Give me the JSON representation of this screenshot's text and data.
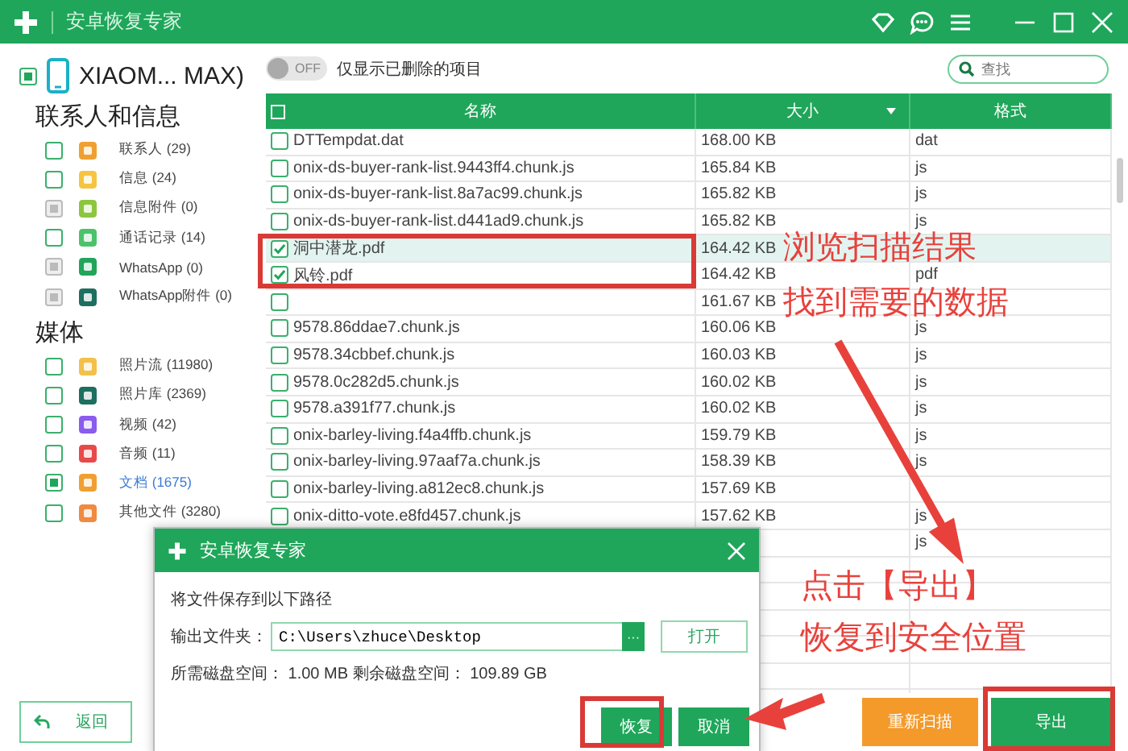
{
  "window": {
    "title": "安卓恢复专家"
  },
  "device": {
    "name": "XIAOM... MAX)",
    "checked": true
  },
  "filter": {
    "toggle_text": "OFF",
    "on": false,
    "label": "仅显示已删除的项目"
  },
  "search": {
    "placeholder": "查找"
  },
  "sidebar": [
    {
      "title": "联系人和信息",
      "items": [
        {
          "label": "联系人 (29)",
          "color": "#f0a030",
          "checked": false,
          "disabled": false,
          "selected": false
        },
        {
          "label": "信息 (24)",
          "color": "#f5c542",
          "checked": false,
          "disabled": false,
          "selected": false
        },
        {
          "label": "信息附件 (0)",
          "color": "#8cc63f",
          "checked": false,
          "disabled": true,
          "selected": false
        },
        {
          "label": "通话记录 (14)",
          "color": "#4cc36a",
          "checked": false,
          "disabled": false,
          "selected": false
        },
        {
          "label": "WhatsApp (0)",
          "color": "#22a55a",
          "checked": false,
          "disabled": true,
          "selected": false
        },
        {
          "label": "WhatsApp附件 (0)",
          "color": "#1d6f5f",
          "checked": false,
          "disabled": true,
          "selected": false
        }
      ]
    },
    {
      "title": "媒体",
      "items": [
        {
          "label": "照片流 (11980)",
          "color": "#f3c04a",
          "checked": false,
          "disabled": false,
          "selected": false
        },
        {
          "label": "照片库 (2369)",
          "color": "#1d6f5f",
          "checked": false,
          "disabled": false,
          "selected": false
        },
        {
          "label": "视频 (42)",
          "color": "#8a5cf0",
          "checked": false,
          "disabled": false,
          "selected": false
        },
        {
          "label": "音频 (11)",
          "color": "#e84a4a",
          "checked": false,
          "disabled": false,
          "selected": false
        },
        {
          "label": "文档 (1675)",
          "color": "#f0a030",
          "checked": true,
          "disabled": false,
          "selected": true
        },
        {
          "label": "其他文件 (3280)",
          "color": "#f08a40",
          "checked": false,
          "disabled": false,
          "selected": false
        }
      ]
    }
  ],
  "table": {
    "all_checked": false,
    "columns": [
      "名称",
      "大小",
      "格式"
    ],
    "rows": [
      {
        "name": "DTTempdat.dat",
        "size": "168.00 KB",
        "format": "dat",
        "checked": false,
        "selected": false
      },
      {
        "name": "onix-ds-buyer-rank-list.9443ff4.chunk.js",
        "size": "165.84 KB",
        "format": "js",
        "checked": false,
        "selected": false
      },
      {
        "name": "onix-ds-buyer-rank-list.8a7ac99.chunk.js",
        "size": "165.82 KB",
        "format": "js",
        "checked": false,
        "selected": false
      },
      {
        "name": "onix-ds-buyer-rank-list.d441ad9.chunk.js",
        "size": "165.82 KB",
        "format": "js",
        "checked": false,
        "selected": false
      },
      {
        "name": "洞中潜龙.pdf",
        "size": "164.42 KB",
        "checked": true,
        "selected": true
      },
      {
        "name": "风铃.pdf",
        "size": "164.42 KB",
        "format": "pdf",
        "checked": true,
        "selected": false
      },
      {
        "size": "161.67 KB",
        "checked": false,
        "selected": false
      },
      {
        "name": "9578.86ddae7.chunk.js",
        "size": "160.06 KB",
        "format": "js",
        "checked": false,
        "selected": false
      },
      {
        "name": "9578.34cbbef.chunk.js",
        "size": "160.03 KB",
        "format": "js",
        "checked": false,
        "selected": false
      },
      {
        "name": "9578.0c282d5.chunk.js",
        "size": "160.02 KB",
        "format": "js",
        "checked": false,
        "selected": false
      },
      {
        "name": "9578.a391f77.chunk.js",
        "size": "160.02 KB",
        "format": "js",
        "checked": false,
        "selected": false
      },
      {
        "name": "onix-barley-living.f4a4ffb.chunk.js",
        "size": "159.79 KB",
        "format": "js",
        "checked": false,
        "selected": false
      },
      {
        "name": "onix-barley-living.97aaf7a.chunk.js",
        "size": "158.39 KB",
        "format": "js",
        "checked": false,
        "selected": false
      },
      {
        "name": "onix-barley-living.a812ec8.chunk.js",
        "size": "157.69 KB",
        "checked": false,
        "selected": false
      },
      {
        "name": "onix-ditto-vote.e8fd457.chunk.js",
        "size": "157.62 KB",
        "format": "js",
        "checked": false,
        "selected": false
      },
      {
        "format": "js",
        "selected": false
      }
    ]
  },
  "footer": {
    "back": "返回",
    "rescan": "重新扫描",
    "export": "导出"
  },
  "dialog": {
    "title": "安卓恢复专家",
    "message": "将文件保存到以下路径",
    "folder_label": "输出文件夹：",
    "folder": "C:\\Users\\zhuce\\Desktop",
    "browse": "···",
    "open": "打开",
    "space": "所需磁盘空间： 1.00 MB 剩余磁盘空间： 109.89 GB",
    "ok": "恢复",
    "cancel": "取消"
  },
  "annotations": [
    {
      "kind": "top",
      "lines": [
        "浏览扫描结果",
        "找到需要的数据"
      ]
    },
    {
      "kind": "bottom",
      "lines": [
        "点击【导出】",
        "恢复到安全位置"
      ]
    }
  ]
}
